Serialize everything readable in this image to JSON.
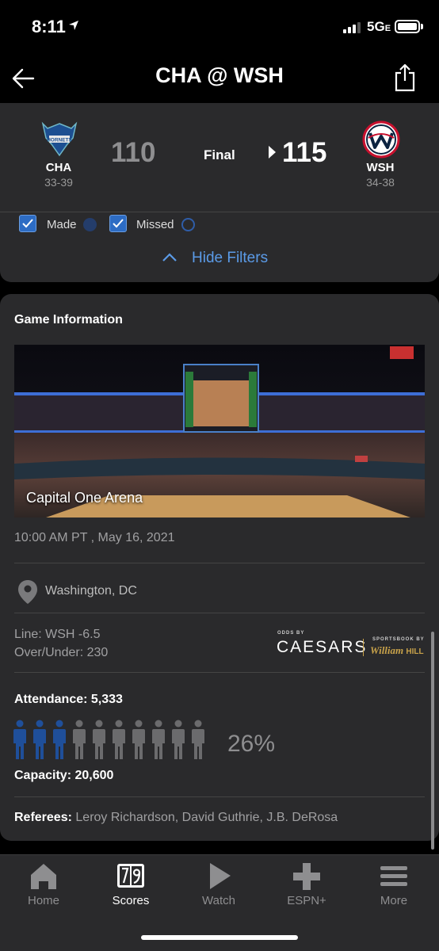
{
  "status_bar": {
    "time": "8:11",
    "network": "5G",
    "network_suffix": "E"
  },
  "header": {
    "title": "CHA @ WSH"
  },
  "game": {
    "away": {
      "abbr": "CHA",
      "record": "33-39",
      "score": "110"
    },
    "home": {
      "abbr": "WSH",
      "record": "34-38",
      "score": "115"
    },
    "status": "Final"
  },
  "filters": {
    "made_label": "Made",
    "missed_label": "Missed",
    "toggle_label": "Hide Filters"
  },
  "game_info": {
    "title": "Game Information",
    "venue": "Capital One Arena",
    "datetime": "10:00 AM PT , May 16, 2021",
    "location": "Washington, DC",
    "line": "Line: WSH -6.5",
    "over_under": "Over/Under: 230",
    "odds_by": "ODDS BY",
    "odds_provider": "CAESARS",
    "sportsbook_by": "SPORTSBOOK BY",
    "sportsbook_name": "William",
    "sportsbook_suffix": "HILL",
    "attendance": "Attendance: 5,333",
    "capacity_pct": "26%",
    "capacity_fraction": 0.26,
    "capacity": "Capacity: 20,600",
    "referees_label": "Referees:",
    "referees": "Leroy Richardson, David Guthrie, J.B. DeRosa"
  },
  "colors": {
    "accent": "#5b9be8",
    "card": "#2a2a2c",
    "filled_person": "#1f4f9a",
    "empty_person": "#6b6b6d"
  },
  "tabs": [
    {
      "label": "Home",
      "icon": "home-icon"
    },
    {
      "label": "Scores",
      "icon": "scores-icon"
    },
    {
      "label": "Watch",
      "icon": "play-icon"
    },
    {
      "label": "ESPN+",
      "icon": "plus-icon"
    },
    {
      "label": "More",
      "icon": "menu-icon"
    }
  ]
}
